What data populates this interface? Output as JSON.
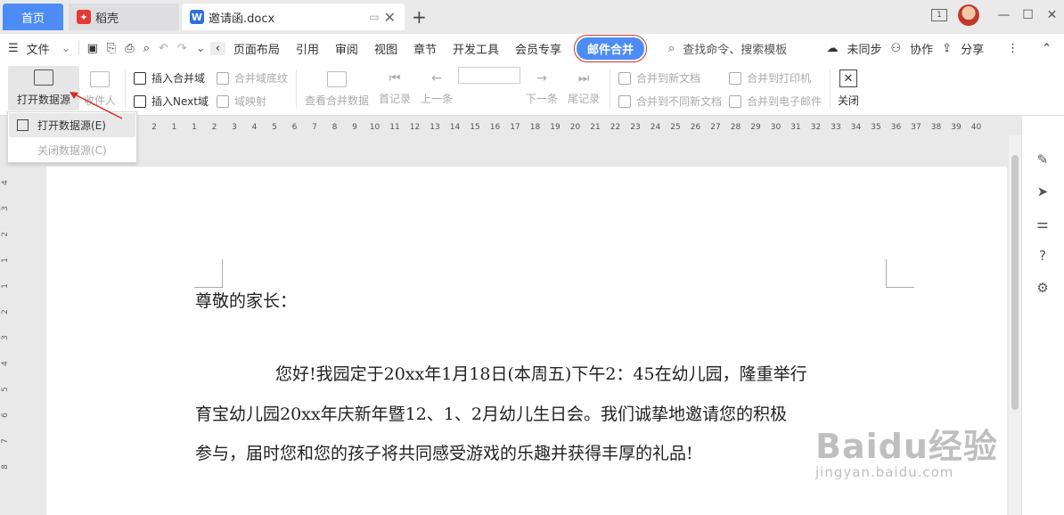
{
  "titlebar": {
    "home_tab": "首页",
    "tabs": [
      {
        "label": "稻壳"
      },
      {
        "label": "邀请函.docx"
      }
    ],
    "window_badge": "1"
  },
  "menubar": {
    "file": "文件",
    "items": [
      "页面布局",
      "引用",
      "审阅",
      "视图",
      "章节",
      "开发工具",
      "会员专享"
    ],
    "active": "邮件合并",
    "search": "查找命令、搜索模板",
    "sync": "未同步",
    "collab": "协作",
    "share": "分享"
  },
  "ribbon": {
    "open_ds": "打开数据源",
    "recipients": "收件人",
    "insert_field": "插入合并域",
    "field_shading": "合并域底纹",
    "insert_next": "插入Next域",
    "field_map": "域映射",
    "view_merged": "查看合并数据",
    "first": "首记录",
    "prev": "上一条",
    "next": "下一条",
    "last": "尾记录",
    "merge_new_doc": "合并到新文档",
    "merge_diff_doc": "合并到不同新文档",
    "merge_printer": "合并到打印机",
    "merge_email": "合并到电子邮件",
    "close": "关闭"
  },
  "dropdown": {
    "open": "打开数据源(E)",
    "close": "关闭数据源(C)"
  },
  "ruler": {
    "ticks": [
      "2",
      "1",
      "1",
      "2",
      "3",
      "4",
      "5",
      "6",
      "7",
      "8",
      "9",
      "10",
      "11",
      "12",
      "13",
      "14",
      "15",
      "16",
      "17",
      "18",
      "19",
      "20",
      "21",
      "22",
      "23",
      "24",
      "25",
      "26",
      "27",
      "28",
      "29",
      "30",
      "31",
      "32",
      "33",
      "34",
      "35",
      "36",
      "37",
      "38",
      "39",
      "40"
    ],
    "vticks": [
      "4",
      "3",
      "2",
      "1",
      "1",
      "2",
      "3",
      "4",
      "5",
      "6",
      "7",
      "8"
    ]
  },
  "document": {
    "salutation": "尊敬的家长：",
    "line1": "您好!我园定于20xx年1月18日(本周五)下午2：45在幼儿园，隆重举行",
    "line2": "育宝幼儿园20xx年庆新年暨12、1、2月幼儿生日会。我们诚挚地邀请您的积极",
    "line3": "参与，届时您和您的孩子将共同感受游戏的乐趣并获得丰厚的礼品!"
  },
  "watermark": {
    "main": "Baidu经验",
    "sub": "jingyan.baidu.com"
  },
  "colors": {
    "accent": "#4d8cf5",
    "highlight_border": "#c0392b"
  }
}
